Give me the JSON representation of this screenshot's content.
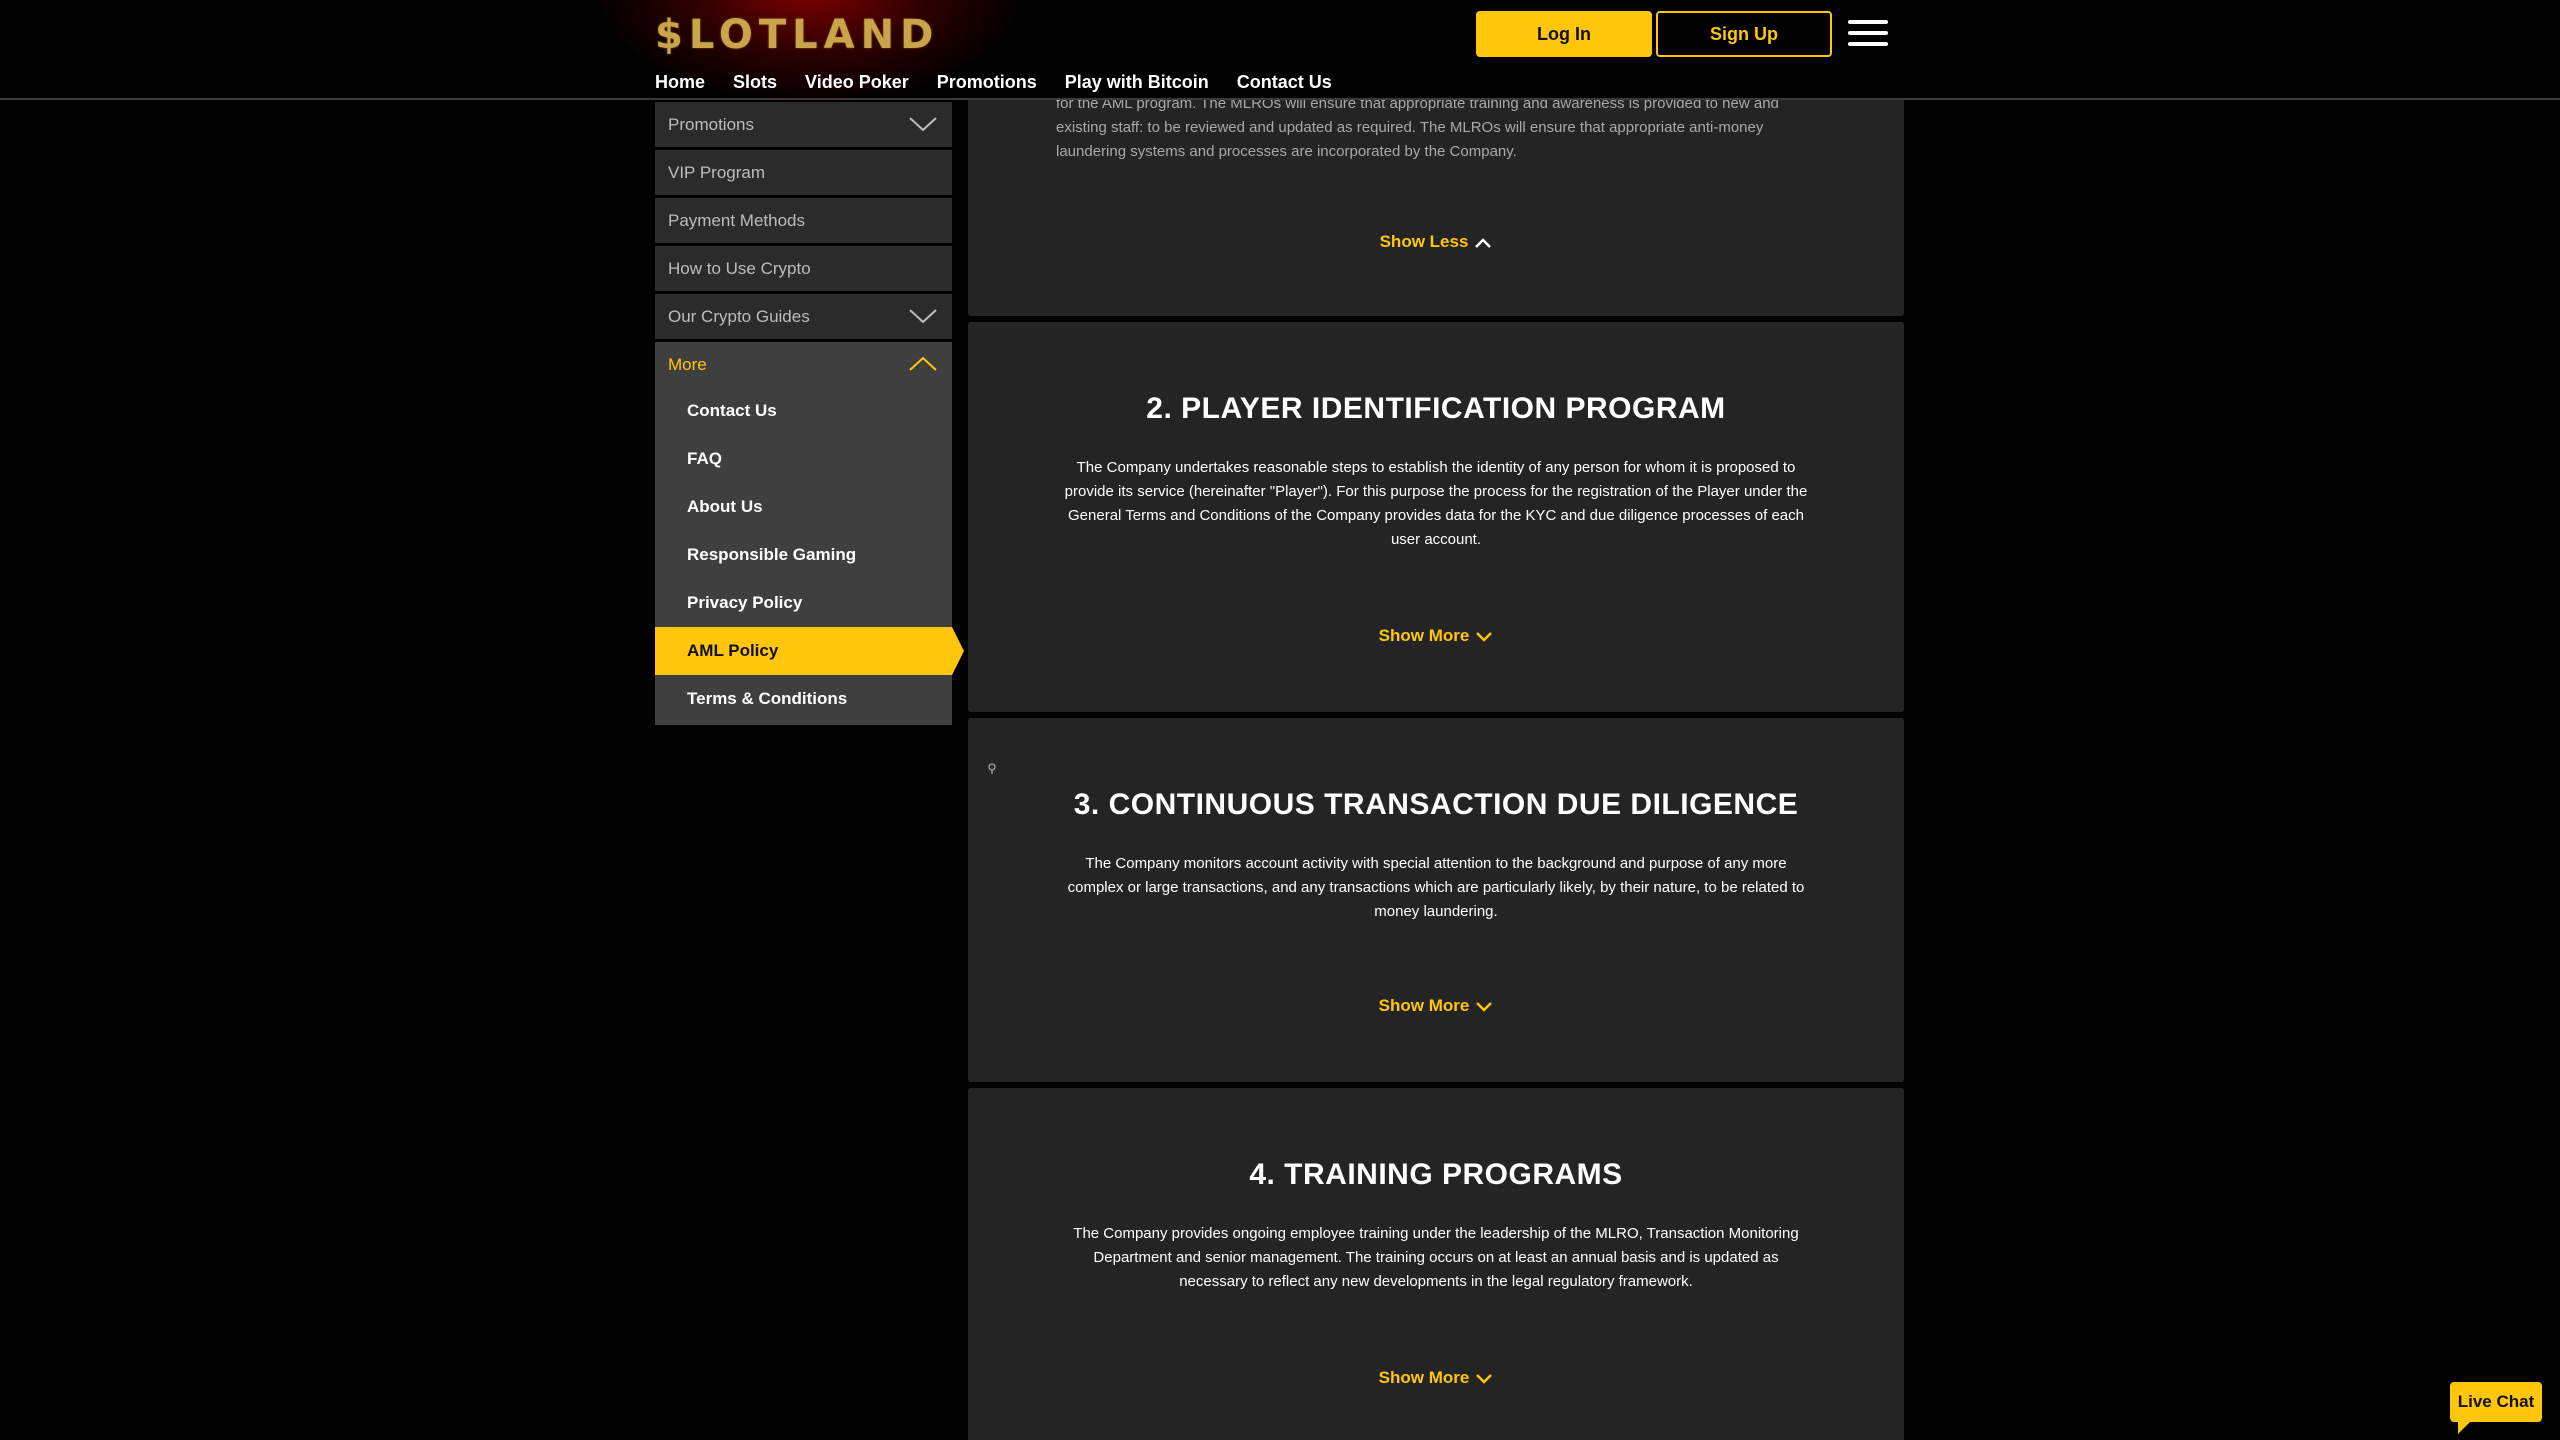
{
  "header": {
    "logo": "$LOTLAND",
    "nav": [
      "Home",
      "Slots",
      "Video Poker",
      "Promotions",
      "Play with Bitcoin",
      "Contact Us"
    ],
    "login_label": "Log In",
    "signup_label": "Sign Up"
  },
  "sidebar": {
    "items": [
      {
        "label": "Promotions",
        "expandable": true
      },
      {
        "label": "VIP Program"
      },
      {
        "label": "Payment Methods"
      },
      {
        "label": "How to Use Crypto"
      },
      {
        "label": "Our Crypto Guides",
        "expandable": true
      }
    ],
    "open_item": {
      "label": "More"
    },
    "sub_items": [
      "Contact Us",
      "FAQ",
      "About Us",
      "Responsible Gaming",
      "Privacy Policy",
      "AML Policy",
      "Terms & Conditions"
    ],
    "active_sub_item": "AML Policy"
  },
  "sections": [
    {
      "title": "",
      "text": "for the AML program. The MLROs will ensure that appropriate training and awareness is provided to new and existing staff: to be reviewed and updated as required. The MLROs will ensure that appropriate anti-money laundering systems and processes are incorporated by the Company.",
      "toggle": "Show Less"
    },
    {
      "title": "2. PLAYER IDENTIFICATION PROGRAM",
      "text": "The Company undertakes reasonable steps to establish the identity of any person for whom it is proposed to provide its service (hereinafter \"Player\"). For this purpose the process for the registration of the Player under the General Terms and Conditions of the Company provides data for the KYC and due diligence processes of each user account.",
      "toggle": "Show More"
    },
    {
      "title": "3. CONTINUOUS TRANSACTION DUE DILIGENCE",
      "text": "The Company monitors account activity with special attention to the background and purpose of any more complex or large transactions, and any transactions which are particularly likely, by their nature, to be related to money laundering.",
      "toggle": "Show More"
    },
    {
      "title": "4. TRAINING PROGRAMS",
      "text": "The Company provides ongoing employee training under the leadership of the MLRO, Transaction Monitoring Department and senior management. The training occurs on at least an annual basis and is updated as necessary to reflect any new developments in the legal regulatory framework.",
      "toggle": "Show More"
    }
  ],
  "live_chat_label": "Live Chat",
  "colors": {
    "accent": "#ffc60b",
    "card": "#242424",
    "sidebar": "#2b2b2b"
  }
}
